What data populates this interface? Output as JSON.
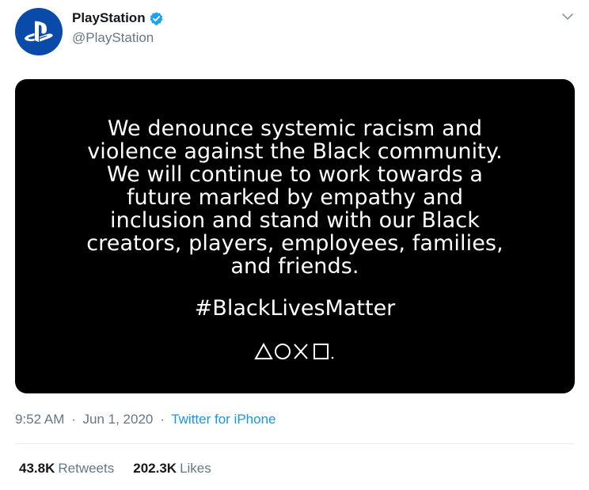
{
  "author": {
    "display_name": "PlayStation",
    "handle": "@PlayStation",
    "avatar_icon": "playstation-logo-icon",
    "avatar_color": "#0a4aa8",
    "verified": true,
    "verified_color": "#1da1f2"
  },
  "media": {
    "background": "#000000",
    "lines": [
      "We denounce systemic racism and",
      "violence against the Black community.",
      "We will continue to work towards a",
      "future marked by empathy and",
      "inclusion and stand with our Black",
      "creators, players, employees, families,",
      "and friends."
    ],
    "hashtag": "#BlackLivesMatter",
    "symbols_icon": "playstation-shapes-icon"
  },
  "meta": {
    "time": "9:52 AM",
    "separator": "·",
    "date": "Jun 1, 2020",
    "source": "Twitter for iPhone",
    "link_color": "#1b95e0"
  },
  "stats": {
    "retweets_count": "43.8K",
    "retweets_label": "Retweets",
    "likes_count": "202.3K",
    "likes_label": "Likes"
  }
}
